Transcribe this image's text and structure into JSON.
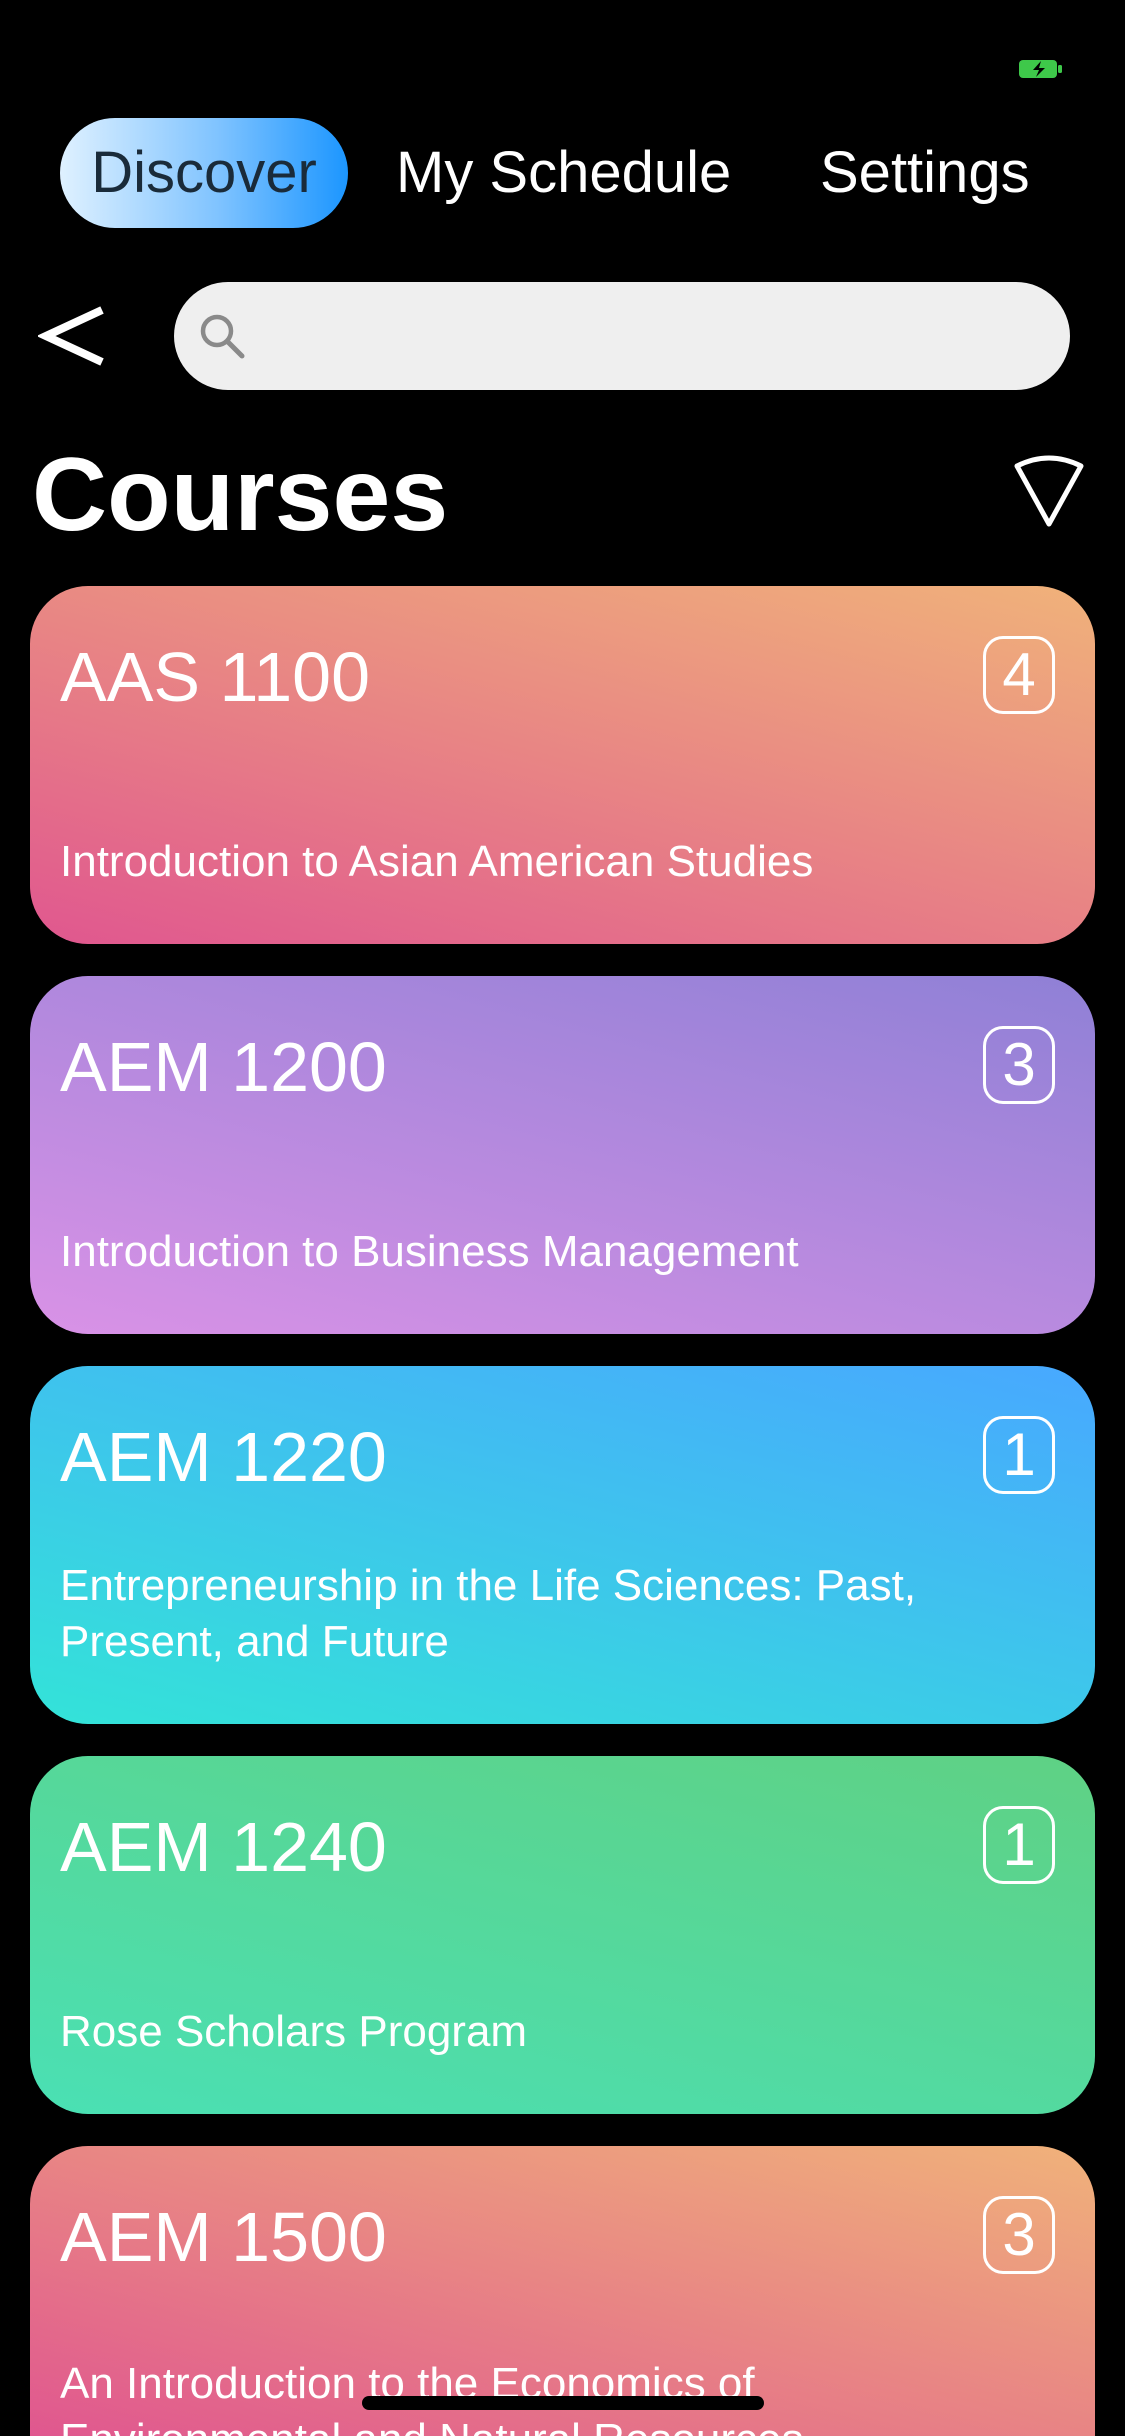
{
  "status_bar": {
    "battery_icon": "battery-charging-icon",
    "battery_color": "#3ec84a"
  },
  "tabs": [
    {
      "label": "Discover",
      "active": true
    },
    {
      "label": "My Schedule",
      "active": false
    },
    {
      "label": "Settings",
      "active": false
    }
  ],
  "search": {
    "back_icon": "chevron-left-icon",
    "search_icon": "search-icon",
    "placeholder": "",
    "value": ""
  },
  "page": {
    "title": "Courses",
    "filter_icon": "filter-triangle-icon"
  },
  "courses": [
    {
      "code": "AAS 1100",
      "credits": "4",
      "name": "Introduction to Asian American Studies",
      "gradient": [
        "#e0578f",
        "#f0b27a"
      ]
    },
    {
      "code": "AEM 1200",
      "credits": "3",
      "name": "Introduction to Business Management",
      "gradient": [
        "#d992e6",
        "#8f80d6"
      ]
    },
    {
      "code": "AEM 1220",
      "credits": "1",
      "name": "Entrepreneurship in the Life Sciences: Past, Present, and Future",
      "gradient": [
        "#33e3d8",
        "#48a8ff"
      ]
    },
    {
      "code": "AEM 1240",
      "credits": "1",
      "name": "Rose Scholars Program",
      "gradient": [
        "#4ae0b4",
        "#5fd184"
      ]
    },
    {
      "code": "AEM 1500",
      "credits": "3",
      "name": "An Introduction to the Economics of Environmental and Natural Resources",
      "gradient": [
        "#e0578f",
        "#f0b27a"
      ]
    }
  ]
}
